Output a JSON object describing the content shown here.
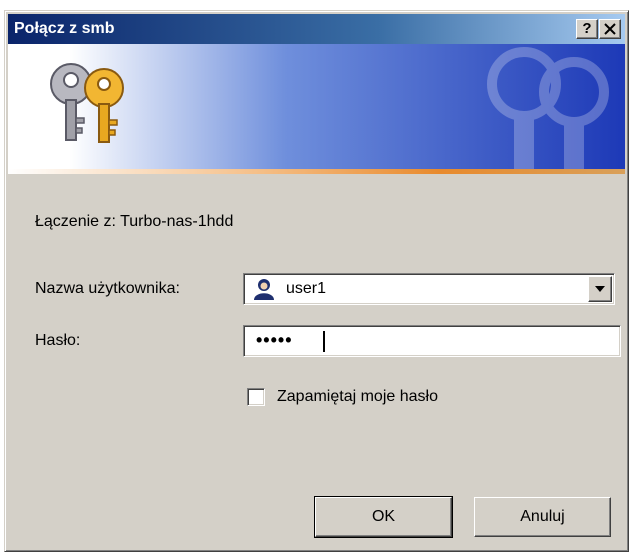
{
  "window": {
    "title": "Połącz z smb",
    "help_label": "?",
    "close_label": "✕"
  },
  "dialog": {
    "connecting_text": "Łączenie z: Turbo-nas-1hdd",
    "username_label": "Nazwa użytkownika:",
    "username_value": "user1",
    "password_label": "Hasło:",
    "password_value": "•••••",
    "remember_label": "Zapamiętaj moje hasło",
    "remember_checked": false
  },
  "buttons": {
    "ok_label": "OK",
    "cancel_label": "Anuluj"
  },
  "colors": {
    "titlebar": "#0a246a",
    "dialog_bg": "#d4d0c8",
    "banner_blue": "#1d39b7",
    "banner_orange": "#e88a2d"
  }
}
